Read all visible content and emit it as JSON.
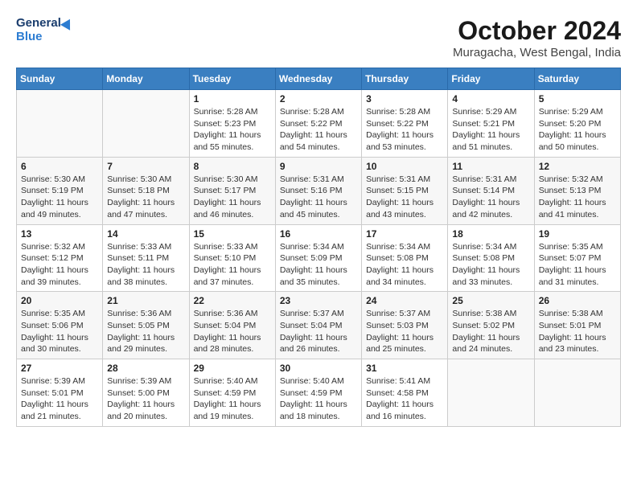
{
  "header": {
    "logo_general": "General",
    "logo_blue": "Blue",
    "month_title": "October 2024",
    "location": "Muragacha, West Bengal, India"
  },
  "weekdays": [
    "Sunday",
    "Monday",
    "Tuesday",
    "Wednesday",
    "Thursday",
    "Friday",
    "Saturday"
  ],
  "weeks": [
    [
      {
        "day": "",
        "info": ""
      },
      {
        "day": "",
        "info": ""
      },
      {
        "day": "1",
        "info": "Sunrise: 5:28 AM\nSunset: 5:23 PM\nDaylight: 11 hours\nand 55 minutes."
      },
      {
        "day": "2",
        "info": "Sunrise: 5:28 AM\nSunset: 5:22 PM\nDaylight: 11 hours\nand 54 minutes."
      },
      {
        "day": "3",
        "info": "Sunrise: 5:28 AM\nSunset: 5:22 PM\nDaylight: 11 hours\nand 53 minutes."
      },
      {
        "day": "4",
        "info": "Sunrise: 5:29 AM\nSunset: 5:21 PM\nDaylight: 11 hours\nand 51 minutes."
      },
      {
        "day": "5",
        "info": "Sunrise: 5:29 AM\nSunset: 5:20 PM\nDaylight: 11 hours\nand 50 minutes."
      }
    ],
    [
      {
        "day": "6",
        "info": "Sunrise: 5:30 AM\nSunset: 5:19 PM\nDaylight: 11 hours\nand 49 minutes."
      },
      {
        "day": "7",
        "info": "Sunrise: 5:30 AM\nSunset: 5:18 PM\nDaylight: 11 hours\nand 47 minutes."
      },
      {
        "day": "8",
        "info": "Sunrise: 5:30 AM\nSunset: 5:17 PM\nDaylight: 11 hours\nand 46 minutes."
      },
      {
        "day": "9",
        "info": "Sunrise: 5:31 AM\nSunset: 5:16 PM\nDaylight: 11 hours\nand 45 minutes."
      },
      {
        "day": "10",
        "info": "Sunrise: 5:31 AM\nSunset: 5:15 PM\nDaylight: 11 hours\nand 43 minutes."
      },
      {
        "day": "11",
        "info": "Sunrise: 5:31 AM\nSunset: 5:14 PM\nDaylight: 11 hours\nand 42 minutes."
      },
      {
        "day": "12",
        "info": "Sunrise: 5:32 AM\nSunset: 5:13 PM\nDaylight: 11 hours\nand 41 minutes."
      }
    ],
    [
      {
        "day": "13",
        "info": "Sunrise: 5:32 AM\nSunset: 5:12 PM\nDaylight: 11 hours\nand 39 minutes."
      },
      {
        "day": "14",
        "info": "Sunrise: 5:33 AM\nSunset: 5:11 PM\nDaylight: 11 hours\nand 38 minutes."
      },
      {
        "day": "15",
        "info": "Sunrise: 5:33 AM\nSunset: 5:10 PM\nDaylight: 11 hours\nand 37 minutes."
      },
      {
        "day": "16",
        "info": "Sunrise: 5:34 AM\nSunset: 5:09 PM\nDaylight: 11 hours\nand 35 minutes."
      },
      {
        "day": "17",
        "info": "Sunrise: 5:34 AM\nSunset: 5:08 PM\nDaylight: 11 hours\nand 34 minutes."
      },
      {
        "day": "18",
        "info": "Sunrise: 5:34 AM\nSunset: 5:08 PM\nDaylight: 11 hours\nand 33 minutes."
      },
      {
        "day": "19",
        "info": "Sunrise: 5:35 AM\nSunset: 5:07 PM\nDaylight: 11 hours\nand 31 minutes."
      }
    ],
    [
      {
        "day": "20",
        "info": "Sunrise: 5:35 AM\nSunset: 5:06 PM\nDaylight: 11 hours\nand 30 minutes."
      },
      {
        "day": "21",
        "info": "Sunrise: 5:36 AM\nSunset: 5:05 PM\nDaylight: 11 hours\nand 29 minutes."
      },
      {
        "day": "22",
        "info": "Sunrise: 5:36 AM\nSunset: 5:04 PM\nDaylight: 11 hours\nand 28 minutes."
      },
      {
        "day": "23",
        "info": "Sunrise: 5:37 AM\nSunset: 5:04 PM\nDaylight: 11 hours\nand 26 minutes."
      },
      {
        "day": "24",
        "info": "Sunrise: 5:37 AM\nSunset: 5:03 PM\nDaylight: 11 hours\nand 25 minutes."
      },
      {
        "day": "25",
        "info": "Sunrise: 5:38 AM\nSunset: 5:02 PM\nDaylight: 11 hours\nand 24 minutes."
      },
      {
        "day": "26",
        "info": "Sunrise: 5:38 AM\nSunset: 5:01 PM\nDaylight: 11 hours\nand 23 minutes."
      }
    ],
    [
      {
        "day": "27",
        "info": "Sunrise: 5:39 AM\nSunset: 5:01 PM\nDaylight: 11 hours\nand 21 minutes."
      },
      {
        "day": "28",
        "info": "Sunrise: 5:39 AM\nSunset: 5:00 PM\nDaylight: 11 hours\nand 20 minutes."
      },
      {
        "day": "29",
        "info": "Sunrise: 5:40 AM\nSunset: 4:59 PM\nDaylight: 11 hours\nand 19 minutes."
      },
      {
        "day": "30",
        "info": "Sunrise: 5:40 AM\nSunset: 4:59 PM\nDaylight: 11 hours\nand 18 minutes."
      },
      {
        "day": "31",
        "info": "Sunrise: 5:41 AM\nSunset: 4:58 PM\nDaylight: 11 hours\nand 16 minutes."
      },
      {
        "day": "",
        "info": ""
      },
      {
        "day": "",
        "info": ""
      }
    ]
  ]
}
